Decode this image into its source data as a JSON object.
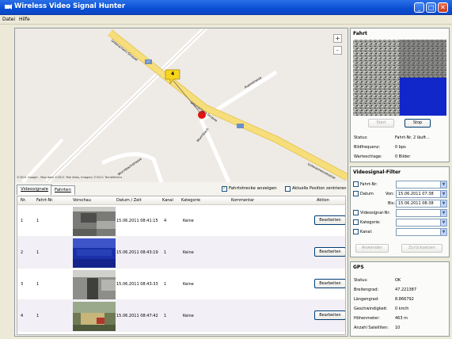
{
  "window": {
    "title": "Wireless Video Signal Hunter"
  },
  "menu": [
    "Datei",
    "Hilfe"
  ],
  "map": {
    "street_main": "Unterachern-Strasse",
    "street_main_2": "Unterachernstrasse",
    "street_b": "Auenstrasse",
    "street_c": "Wurmbach",
    "street_d": "Wurmbachstrasse",
    "road_badge": "17",
    "marker_label": "4",
    "zoom_in": "+",
    "zoom_out": "-",
    "copyright": "©2011 Google - Map data ©2011 Tele Atlas, Imagery ©2011 TerraMetrics"
  },
  "tabs": [
    {
      "label": "Videosignale"
    },
    {
      "label": "Fahrten"
    }
  ],
  "options": {
    "show_route": "Fahrtstrecke anzeigen",
    "show_route_checked": true,
    "center": "Aktuelle Position zentrieren",
    "center_checked": false
  },
  "table": {
    "headers": [
      "Nr.",
      "Fahrt-Nr.",
      "Vorschau",
      "Datum / Zeit",
      "Kanal",
      "Kategorie",
      "Kommentar",
      "Aktion"
    ],
    "rows": [
      {
        "nr": "1",
        "fahrt": "1",
        "datum": "15.06.2011 08:41:15",
        "kanal": "4",
        "kategorie": "Keine",
        "kommentar": "",
        "aktion": "Bearbeiten"
      },
      {
        "nr": "2",
        "fahrt": "1",
        "datum": "15.06.2011 08:43:19",
        "kanal": "1",
        "kategorie": "Keine",
        "kommentar": "",
        "aktion": "Bearbeiten"
      },
      {
        "nr": "3",
        "fahrt": "1",
        "datum": "15.06.2011 08:43:33",
        "kanal": "1",
        "kategorie": "Keine",
        "kommentar": "",
        "aktion": "Bearbeiten"
      },
      {
        "nr": "4",
        "fahrt": "1",
        "datum": "15.06.2011 08:47:42",
        "kanal": "1",
        "kategorie": "Keine",
        "kommentar": "",
        "aktion": "Bearbeiten"
      }
    ]
  },
  "fahrt": {
    "title": "Fahrt",
    "start": "Start",
    "stop": "Stop",
    "status_label": "Status:",
    "status_value": "Fahrt-Nr. 2 läuft...",
    "fps_label": "Bildfrequenz:",
    "fps_value": "0 bps",
    "queue_label": "Warteschlage:",
    "queue_value": "0 Bilder"
  },
  "filter": {
    "title": "Videosignal-Filter",
    "fahrt_nr": "Fahrt-Nr:",
    "datum": "Datum",
    "von": "Von:",
    "von_value": "15.06.2011 07:38",
    "bis": "Bis:",
    "bis_value": "15.06.2011 08:38",
    "signal_nr": "Videosignal-Nr:",
    "kategorie": "Kategorie:",
    "kanal": "Kanal:",
    "apply": "Anwenden",
    "reset": "Zurücksetzen"
  },
  "gps": {
    "title": "GPS",
    "rows": [
      {
        "label": "Status:",
        "value": "OK"
      },
      {
        "label": "Breitengrad:",
        "value": "47.221387"
      },
      {
        "label": "Längengrad:",
        "value": "8.866792"
      },
      {
        "label": "Geschwindigkeit:",
        "value": "0 km/h"
      },
      {
        "label": "Höhenmeter:",
        "value": "463 m"
      },
      {
        "label": "Anzahl Satelliten:",
        "value": "10"
      }
    ]
  }
}
